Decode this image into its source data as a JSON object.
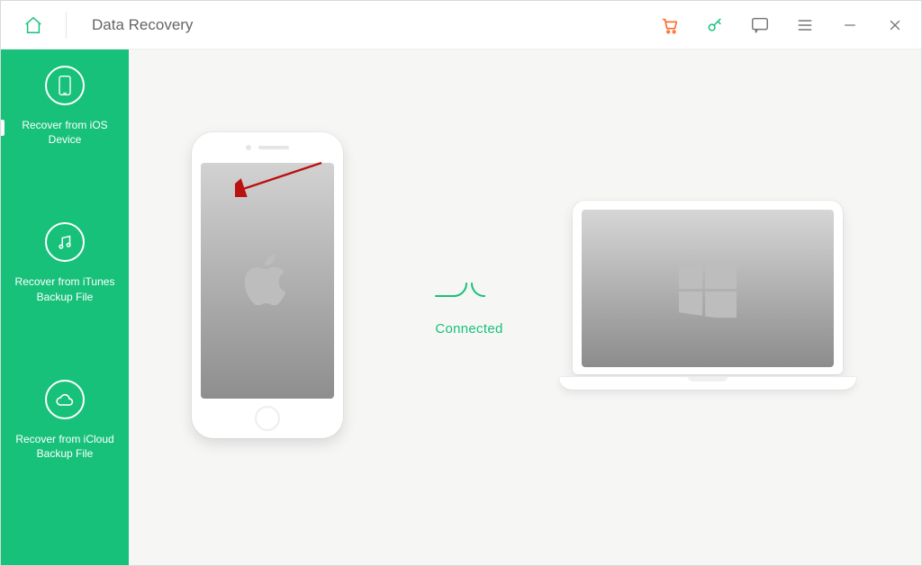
{
  "header": {
    "title": "Data Recovery"
  },
  "sidebar": {
    "items": [
      {
        "icon": "device-icon",
        "label": "Recover from iOS Device",
        "active": true
      },
      {
        "icon": "itunes-icon",
        "label": "Recover from iTunes Backup File",
        "active": false
      },
      {
        "icon": "icloud-icon",
        "label": "Recover from iCloud Backup File",
        "active": false
      }
    ]
  },
  "main": {
    "status_label": "Connected"
  },
  "colors": {
    "accent": "#17c17a",
    "cart": "#ff6a2b"
  }
}
